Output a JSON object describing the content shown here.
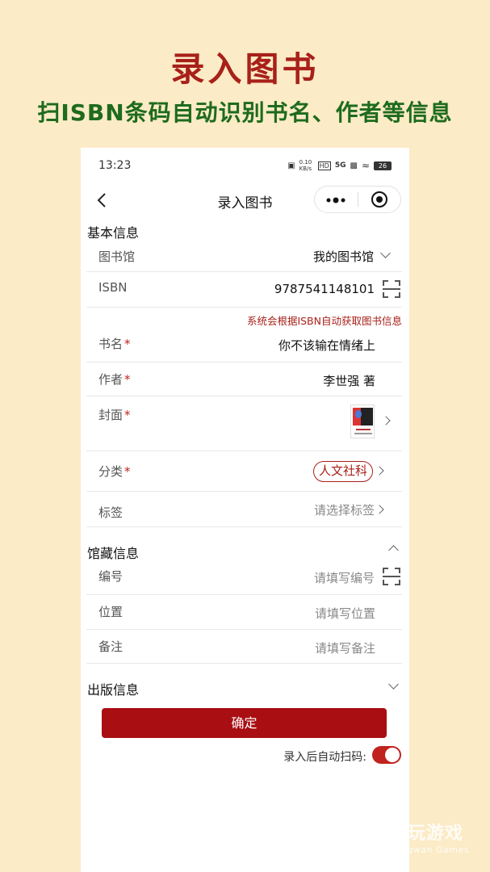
{
  "promo": {
    "title": "录入图书",
    "subtitle": "扫ISBN条码自动识别书名、作者等信息"
  },
  "status_bar": {
    "time": "13:23",
    "network_speed": "0.10 KB/s",
    "hd": "HD",
    "signal": "5G",
    "battery": "26"
  },
  "nav": {
    "title": "录入图书",
    "more_icon": "more-icon",
    "close_icon": "target-icon"
  },
  "basic": {
    "section_title": "基本信息",
    "library_label": "图书馆",
    "library_value": "我的图书馆",
    "isbn_label": "ISBN",
    "isbn_value": "9787541148101",
    "hint": "系统会根据ISBN自动获取图书信息",
    "title_label": "书名",
    "title_value": "你不该输在情绪上",
    "author_label": "作者",
    "author_value": "李世强 著",
    "cover_label": "封面",
    "category_label": "分类",
    "category_value": "人文社科",
    "tags_label": "标签",
    "tags_placeholder": "请选择标签",
    "required_mark": "*"
  },
  "collection": {
    "section_title": "馆藏信息",
    "number_label": "编号",
    "number_placeholder": "请填写编号",
    "location_label": "位置",
    "location_placeholder": "请填写位置",
    "note_label": "备注",
    "note_placeholder": "请填写备注"
  },
  "publish": {
    "section_title": "出版信息"
  },
  "actions": {
    "confirm": "确定",
    "auto_scan_label": "录入后自动扫码:",
    "auto_scan_on": true
  },
  "watermark": {
    "cn": "仍玩游戏",
    "en": "Rengwan Games"
  },
  "colors": {
    "background": "#fbebc6",
    "accent": "#a80e12",
    "promo_title": "#a8201a",
    "promo_subtitle": "#1e6b1e"
  }
}
